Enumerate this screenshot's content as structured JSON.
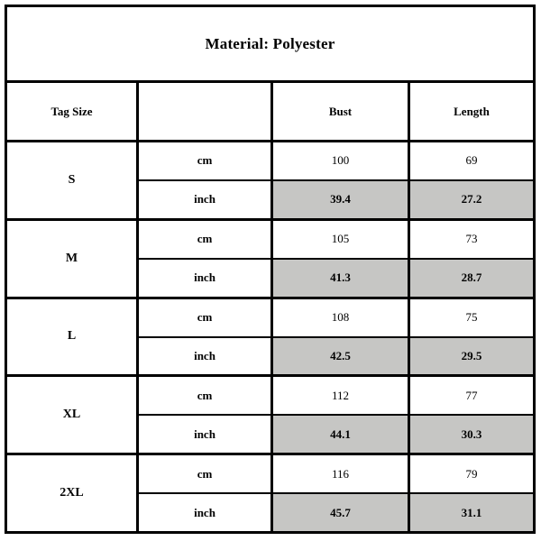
{
  "title": "Material: Polyester",
  "columns": {
    "size": "Tag Size",
    "unit": "",
    "bust": "Bust",
    "length": "Length"
  },
  "units": {
    "cm": "cm",
    "inch": "inch"
  },
  "colors": {
    "border": "#000000",
    "inch_row_highlight": "#c6c6c4",
    "background": "#ffffff",
    "text": "#000000"
  },
  "rows": [
    {
      "size": "S",
      "cm": {
        "unit": "cm",
        "bust": "100",
        "length": "69"
      },
      "inch": {
        "unit": "inch",
        "bust": "39.4",
        "length": "27.2"
      }
    },
    {
      "size": "M",
      "cm": {
        "unit": "cm",
        "bust": "105",
        "length": "73"
      },
      "inch": {
        "unit": "inch",
        "bust": "41.3",
        "length": "28.7"
      }
    },
    {
      "size": "L",
      "cm": {
        "unit": "cm",
        "bust": "108",
        "length": "75"
      },
      "inch": {
        "unit": "inch",
        "bust": "42.5",
        "length": "29.5"
      }
    },
    {
      "size": "XL",
      "cm": {
        "unit": "cm",
        "bust": "112",
        "length": "77"
      },
      "inch": {
        "unit": "inch",
        "bust": "44.1",
        "length": "30.3"
      }
    },
    {
      "size": "2XL",
      "cm": {
        "unit": "cm",
        "bust": "116",
        "length": "79"
      },
      "inch": {
        "unit": "inch",
        "bust": "45.7",
        "length": "31.1"
      }
    }
  ]
}
